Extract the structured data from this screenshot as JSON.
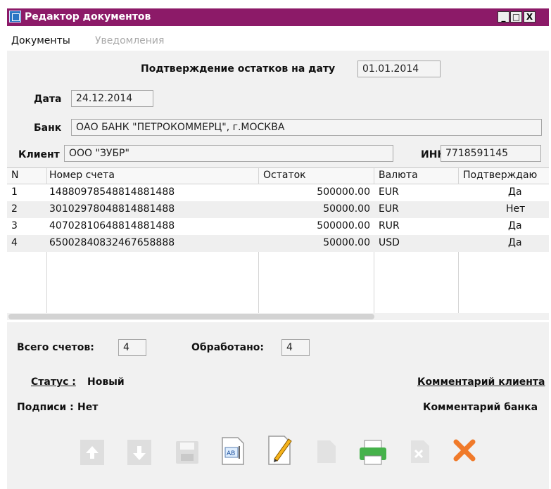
{
  "window": {
    "title": "Редактор документов"
  },
  "titlebar_buttons": {
    "minimize": "_",
    "restore": "□",
    "close": "X"
  },
  "menu": {
    "documents": "Документы",
    "notifications": "Уведомления"
  },
  "form": {
    "confirm_label": "Подтверждение остатков на дату",
    "confirm_date": "01.01.2014",
    "date_label": "Дата",
    "date_value": "24.12.2014",
    "bank_label": "Банк",
    "bank_value": "ОАО БАНК \"ПЕТРОКОММЕРЦ\", г.МОСКВА",
    "client_label": "Клиент",
    "client_value": "ООО \"ЗУБР\"",
    "inn_label": "ИНН",
    "inn_value": "7718591145"
  },
  "table": {
    "headers": [
      "N",
      "Номер счета",
      "Остаток",
      "Валюта",
      "Подтверждаю"
    ],
    "rows": [
      [
        "1",
        "14880978548814881488",
        "500000.00",
        "EUR",
        "Да"
      ],
      [
        "2",
        "30102978048814881488",
        "50000.00",
        "EUR",
        "Нет"
      ],
      [
        "3",
        "40702810648814881488",
        "500000.00",
        "RUR",
        "Да"
      ],
      [
        "4",
        "65002840832467658888",
        "50000.00",
        "USD",
        "Да"
      ]
    ]
  },
  "summary": {
    "total_label": "Всего счетов:",
    "total_value": "4",
    "processed_label": "Обработано:",
    "processed_value": "4",
    "status_label": "Статус :",
    "status_value": "Новый",
    "signatures_label": "Подписи :",
    "signatures_value": "Нет",
    "client_comment": "Комментарий клиента",
    "bank_comment": "Комментарий банка"
  },
  "toolbar": {
    "icons": [
      "arrow-up-icon",
      "arrow-down-icon",
      "save-icon",
      "text-edit-icon",
      "pen-icon",
      "copy-icon",
      "print-icon",
      "delete-icon",
      "cancel-icon"
    ],
    "colors": {
      "active_pen": "#f6b31a",
      "active_print": "#46b24b",
      "cancel": "#f07a2a",
      "inactive": "#d8d8d8"
    }
  },
  "colors": {
    "titlebar": "#8c1a68",
    "form_bg": "#f1f1f1"
  }
}
